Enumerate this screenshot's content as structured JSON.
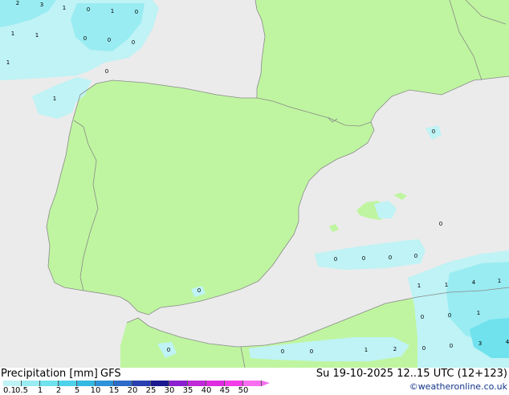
{
  "legend": {
    "title": "Precipitation [mm]",
    "model": "GFS",
    "ticks": [
      "0.1",
      "0.5",
      "1",
      "2",
      "5",
      "10",
      "15",
      "20",
      "25",
      "30",
      "35",
      "40",
      "45",
      "50"
    ],
    "colors": [
      "#bff3f5",
      "#99ecf2",
      "#6fe2ee",
      "#4dd2ea",
      "#33b9e2",
      "#2e92d8",
      "#2d6bc8",
      "#2a3fb0",
      "#1c1a8e",
      "#8a1fd0",
      "#c02ad8",
      "#e02ce0",
      "#f23ce8",
      "#f86ef0"
    ]
  },
  "valid_time": "Su 19-10-2025 12..15 UTC (12+123)",
  "credit": "©weatheronline.co.uk",
  "map": {
    "colors": {
      "sea": "#ebebeb",
      "land": "#bff5a0",
      "border": "#8a8a8a"
    },
    "labels": [
      {
        "text": "2"
      },
      {
        "text": "3"
      },
      {
        "text": "1"
      },
      {
        "text": "0"
      },
      {
        "text": "1"
      },
      {
        "text": "0"
      },
      {
        "text": "1"
      },
      {
        "text": "1"
      },
      {
        "text": "0"
      },
      {
        "text": "0"
      },
      {
        "text": "0"
      },
      {
        "text": "1"
      },
      {
        "text": "0"
      },
      {
        "text": "1"
      },
      {
        "text": "0"
      },
      {
        "text": "0"
      },
      {
        "text": "0"
      },
      {
        "text": "0"
      },
      {
        "text": "0"
      },
      {
        "text": "0"
      },
      {
        "text": "0"
      },
      {
        "text": "1"
      },
      {
        "text": "1"
      },
      {
        "text": "4"
      },
      {
        "text": "1"
      },
      {
        "text": "0"
      },
      {
        "text": "0"
      },
      {
        "text": "1"
      },
      {
        "text": "0"
      },
      {
        "text": "0"
      },
      {
        "text": "0"
      },
      {
        "text": "1"
      },
      {
        "text": "2"
      },
      {
        "text": "0"
      },
      {
        "text": "0"
      },
      {
        "text": "3"
      },
      {
        "text": "4"
      }
    ]
  }
}
